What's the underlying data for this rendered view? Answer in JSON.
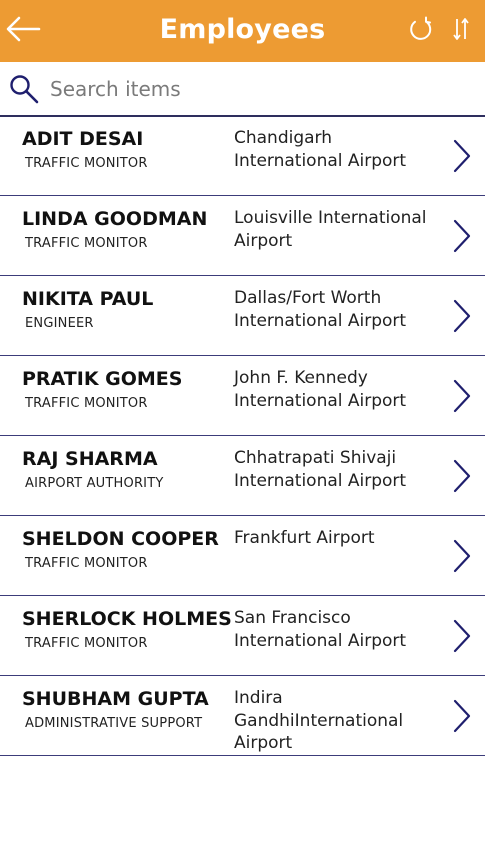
{
  "header": {
    "title": "Employees",
    "background_color": "#ED9B33",
    "back_icon": "arrow-left-icon",
    "refresh_icon": "refresh-icon",
    "sort_icon": "sort-icon"
  },
  "search": {
    "placeholder": "Search items",
    "value": "",
    "icon": "search-icon"
  },
  "employees": [
    {
      "name": "ADIT DESAI",
      "role": "TRAFFIC MONITOR",
      "location": "Chandigarh International Airport"
    },
    {
      "name": "LINDA GOODMAN",
      "role": "TRAFFIC MONITOR",
      "location": "Louisville International Airport"
    },
    {
      "name": "NIKITA PAUL",
      "role": "ENGINEER",
      "location": "Dallas/Fort Worth International Airport"
    },
    {
      "name": "PRATIK GOMES",
      "role": "TRAFFIC MONITOR",
      "location": "John F. Kennedy International Airport"
    },
    {
      "name": "RAJ SHARMA",
      "role": "AIRPORT AUTHORITY",
      "location": "Chhatrapati Shivaji International Airport"
    },
    {
      "name": "SHELDON COOPER",
      "role": "TRAFFIC MONITOR",
      "location": "Frankfurt Airport"
    },
    {
      "name": "SHERLOCK HOLMES",
      "role": "TRAFFIC MONITOR",
      "location": "San Francisco International Airport"
    },
    {
      "name": "SHUBHAM GUPTA",
      "role": "ADMINISTRATIVE SUPPORT",
      "location": "Indira GandhiInternational Airport"
    }
  ],
  "colors": {
    "accent": "#ED9B33",
    "divider": "#3C3C7A",
    "icon": "#1F1F6E"
  }
}
